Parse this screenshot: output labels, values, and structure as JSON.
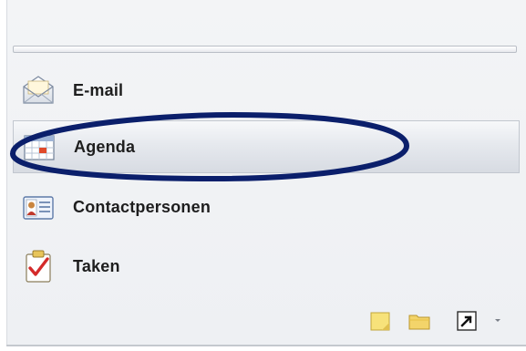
{
  "nav": {
    "items": [
      {
        "label": "E-mail",
        "icon": "mail-envelope-icon",
        "selected": false
      },
      {
        "label": "Agenda",
        "icon": "calendar-icon",
        "selected": true
      },
      {
        "label": "Contactpersonen",
        "icon": "contact-card-icon",
        "selected": false
      },
      {
        "label": "Taken",
        "icon": "task-clipboard-icon",
        "selected": false
      }
    ]
  },
  "toolbar": {
    "icons": [
      "notes-icon",
      "folder-icon",
      "shortcut-icon",
      "configure-buttons-arrow-icon"
    ]
  },
  "colors": {
    "highlight_ellipse": "#0b1f6b",
    "selected_row": "#dfe3e9",
    "panel_bg": "#f1f2f5"
  }
}
